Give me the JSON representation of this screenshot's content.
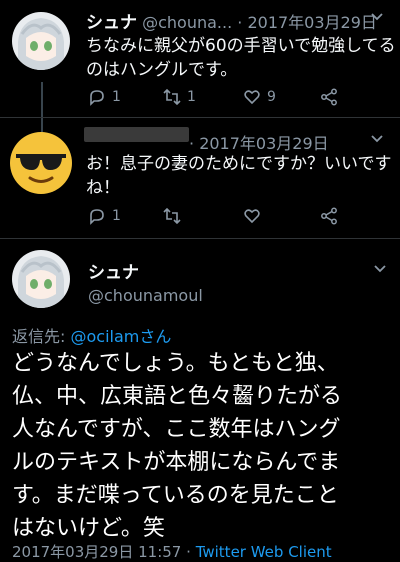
{
  "tweet1": {
    "display_name": "シュナ",
    "handle": "@chouna...",
    "separator": "·",
    "date": "2017年03月29日",
    "text_line1": "ちなみに親父が60の手習いで勉強してる",
    "text_line2": "のはハングルです。",
    "reply_count": "1",
    "retweet_count": "1",
    "like_count": "9"
  },
  "tweet2": {
    "separator": "·",
    "date": "2017年03月29日",
    "text_line1": "お！息子の妻のためにですか？いいです",
    "text_line2": "ね！",
    "reply_count": "1"
  },
  "tweet3": {
    "display_name": "シュナ",
    "handle": "@chounamoul",
    "reply_prefix": "返信先: ",
    "reply_to": "@ocilamさん",
    "lines": [
      "どうなんでしょう。もともと独、",
      "仏、中、広東語と色々齧りたがる",
      "人なんですが、ここ数年はハング",
      "ルのテキストが本棚にならんでま",
      "す。まだ喋っているのを見たこと",
      "はないけど。笑"
    ],
    "timestamp": "2017年03月29日 11:57",
    "separator": "·",
    "client": "Twitter Web Client"
  },
  "icons": [
    "reply-icon",
    "retweet-icon",
    "like-icon",
    "share-icon",
    "chevron-down-icon"
  ],
  "colors": {
    "background": "#000000",
    "muted": "#8b98a5",
    "link": "#1d9bf0",
    "emoji": "#f5c33b"
  }
}
